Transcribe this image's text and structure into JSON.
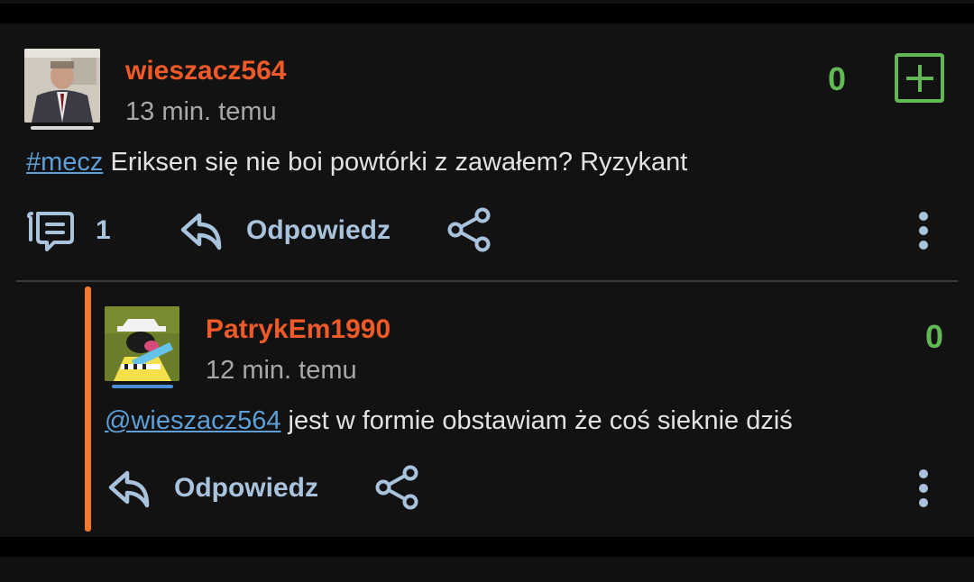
{
  "post": {
    "username": "wieszacz564",
    "timestamp": "13 min. temu",
    "votes": "0",
    "tag": "#mecz",
    "text": " Eriksen się nie boi powtórki z zawałem? Ryzykant",
    "comment_count": "1",
    "reply_label": "Odpowiedz"
  },
  "reply": {
    "username": "PatrykEm1990",
    "timestamp": "12 min. temu",
    "votes": "0",
    "mention": "@wieszacz564",
    "text": " jest w formie obstawiam że coś sieknie dziś",
    "reply_label": "Odpowiedz"
  },
  "colors": {
    "username": "#f05a28",
    "votes": "#62b855",
    "link": "#5d9fd6",
    "action": "#a9c3dd",
    "reply_bar": "#f37a2c"
  },
  "icons": [
    "comments-icon",
    "reply-arrow-icon",
    "share-icon",
    "more-vertical-icon",
    "plus-icon"
  ]
}
